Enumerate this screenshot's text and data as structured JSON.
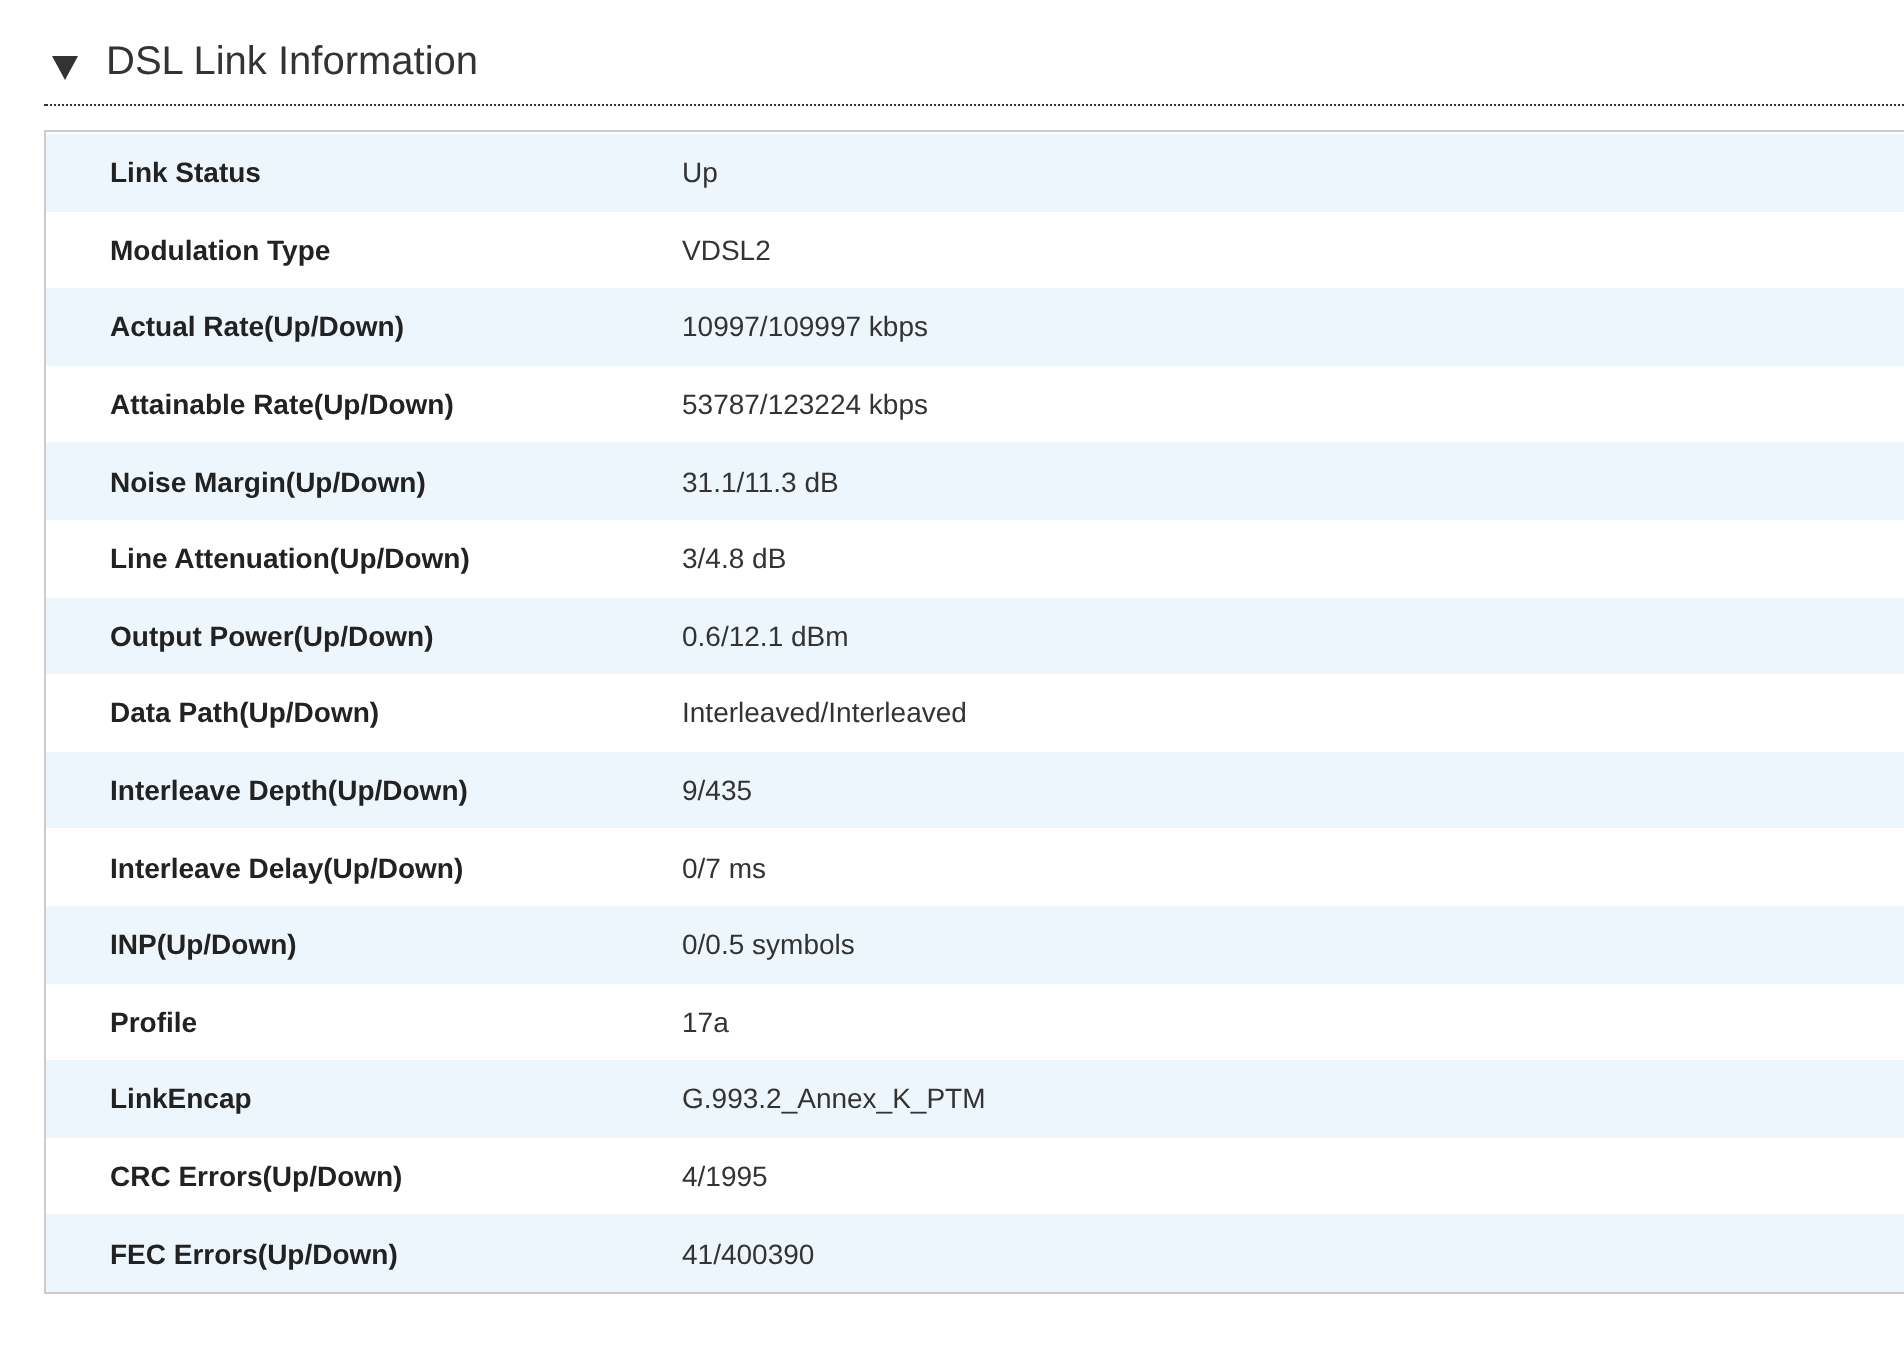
{
  "section": {
    "title": "DSL Link Information",
    "expanded": true
  },
  "rows": [
    {
      "label": "Link Status",
      "value": "Up"
    },
    {
      "label": "Modulation Type",
      "value": "VDSL2"
    },
    {
      "label": "Actual Rate(Up/Down)",
      "value": "10997/109997 kbps"
    },
    {
      "label": "Attainable Rate(Up/Down)",
      "value": "53787/123224 kbps"
    },
    {
      "label": "Noise Margin(Up/Down)",
      "value": "31.1/11.3 dB"
    },
    {
      "label": "Line Attenuation(Up/Down)",
      "value": "3/4.8 dB"
    },
    {
      "label": "Output Power(Up/Down)",
      "value": "0.6/12.1 dBm"
    },
    {
      "label": "Data Path(Up/Down)",
      "value": "Interleaved/Interleaved"
    },
    {
      "label": "Interleave Depth(Up/Down)",
      "value": "9/435"
    },
    {
      "label": "Interleave Delay(Up/Down)",
      "value": "0/7 ms"
    },
    {
      "label": "INP(Up/Down)",
      "value": "0/0.5 symbols"
    },
    {
      "label": "Profile",
      "value": "17a"
    },
    {
      "label": "LinkEncap",
      "value": "G.993.2_Annex_K_PTM"
    },
    {
      "label": "CRC Errors(Up/Down)",
      "value": "4/1995"
    },
    {
      "label": "FEC Errors(Up/Down)",
      "value": "41/400390"
    }
  ]
}
